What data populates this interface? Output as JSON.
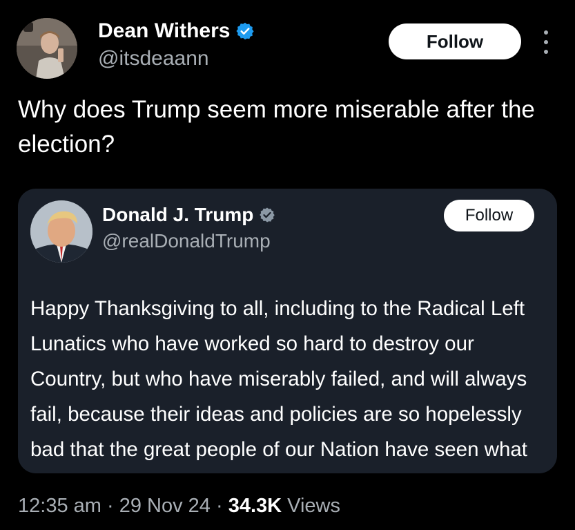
{
  "author": {
    "name": "Dean Withers",
    "handle": "@itsdeaann",
    "follow_label": "Follow"
  },
  "tweet": {
    "text": "Why does Trump seem more miserable after the election?"
  },
  "quoted": {
    "name": "Donald J. Trump",
    "handle": "@realDonaldTrump",
    "follow_label": "Follow",
    "text": "Happy Thanksgiving to all, including to the Radical Left Lunatics who have worked so hard to destroy our Country, but who have miserably failed, and will always fail, because their ideas and policies are so hopelessly bad that the great people of our Nation have seen what all this evil has done"
  },
  "meta": {
    "time": "12:35 am",
    "separator": "·",
    "date": "29 Nov 24",
    "views_count": "34.3K",
    "views_label": "Views"
  },
  "colors": {
    "background": "#000000",
    "card": "#1a202a",
    "verified": "#1d9bf0",
    "secondary_text": "#a9afb5"
  },
  "icons": {
    "verified": "verified-badge-icon",
    "more": "more-options-icon"
  }
}
